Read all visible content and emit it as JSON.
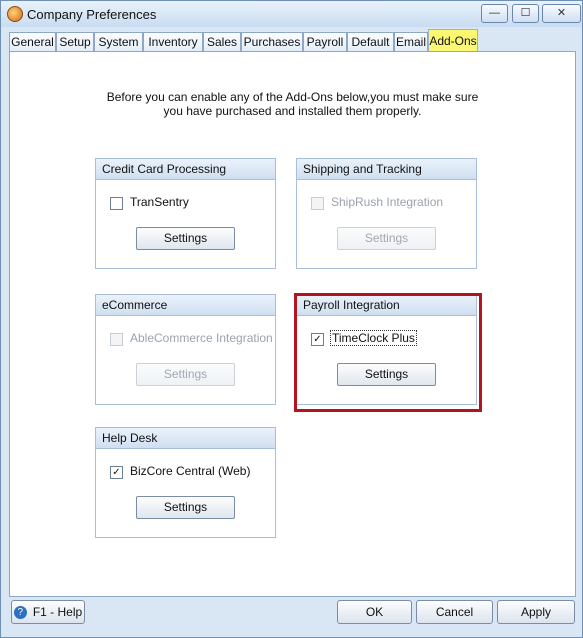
{
  "window": {
    "title": "Company Preferences",
    "controls": {
      "minimize": "—",
      "maximize": "☐",
      "close": "✕"
    }
  },
  "tabs": [
    "General",
    "Setup",
    "System",
    "Inventory",
    "Sales",
    "Purchases",
    "Payroll",
    "Default",
    "Email",
    "Add-Ons"
  ],
  "active_tab": "Add-Ons",
  "intro": {
    "line1": "Before you can enable any of the Add-Ons below,you must make sure",
    "line2": "you have purchased and installed them properly."
  },
  "groups": {
    "credit_card": {
      "title": "Credit Card Processing",
      "option": "TranSentry",
      "checked": false,
      "enabled": true,
      "button": "Settings"
    },
    "shipping": {
      "title": "Shipping and Tracking",
      "option": "ShipRush Integration",
      "checked": false,
      "enabled": false,
      "button": "Settings"
    },
    "ecommerce": {
      "title": "eCommerce",
      "option": "AbleCommerce Integration",
      "checked": false,
      "enabled": false,
      "button": "Settings"
    },
    "payroll": {
      "title": "Payroll Integration",
      "option": "TimeClock Plus",
      "checked": true,
      "enabled": true,
      "button": "Settings"
    },
    "helpdesk": {
      "title": "Help Desk",
      "option": "BizCore Central (Web)",
      "checked": true,
      "enabled": true,
      "button": "Settings"
    }
  },
  "footer": {
    "help": "F1 - Help",
    "ok": "OK",
    "cancel": "Cancel",
    "apply": "Apply"
  },
  "colors": {
    "highlight": "#b3141f",
    "active_tab": "#fbf772"
  }
}
